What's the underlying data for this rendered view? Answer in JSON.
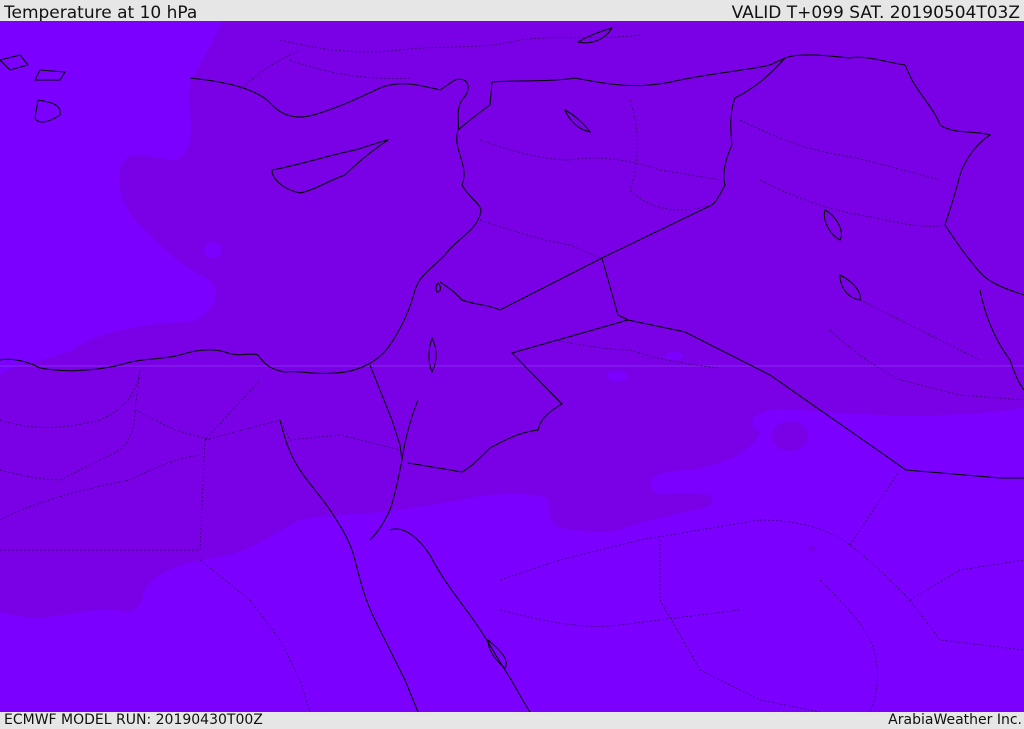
{
  "header": {
    "title": "Temperature at 10 hPa",
    "valid_time": "VALID T+099 SAT. 20190504T03Z"
  },
  "footer": {
    "model_run": "ECMWF MODEL RUN: 20190430T00Z",
    "credit": "ArabiaWeather Inc."
  },
  "colors": {
    "warm_band": "#7a00e6",
    "cool_band": "#7b00ff",
    "borders": "#000000",
    "bars": "#e6e6e6"
  }
}
